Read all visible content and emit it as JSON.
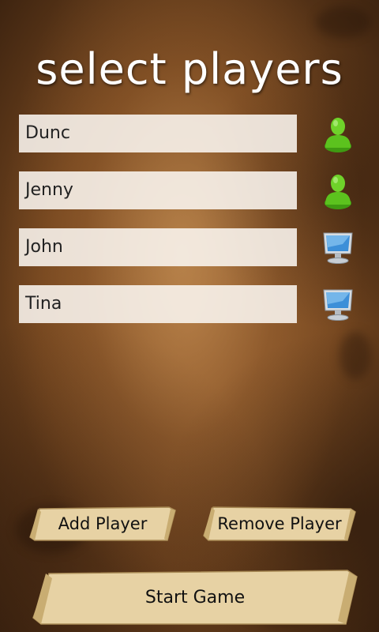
{
  "screen": {
    "title": "select players"
  },
  "players": [
    {
      "name": "Dunc",
      "type_icon": "human-player-icon"
    },
    {
      "name": "Jenny",
      "type_icon": "human-player-icon"
    },
    {
      "name": "John",
      "type_icon": "computer-player-icon"
    },
    {
      "name": "Tina",
      "type_icon": "computer-player-icon"
    }
  ],
  "buttons": {
    "add_player": "Add Player",
    "remove_player": "Remove Player",
    "start_game": "Start Game"
  },
  "colors": {
    "human_icon": "#5cc21e",
    "computer_icon": "#3d8fd8",
    "scroll_paper": "#e7d2a4",
    "title_text": "#ffffff"
  }
}
